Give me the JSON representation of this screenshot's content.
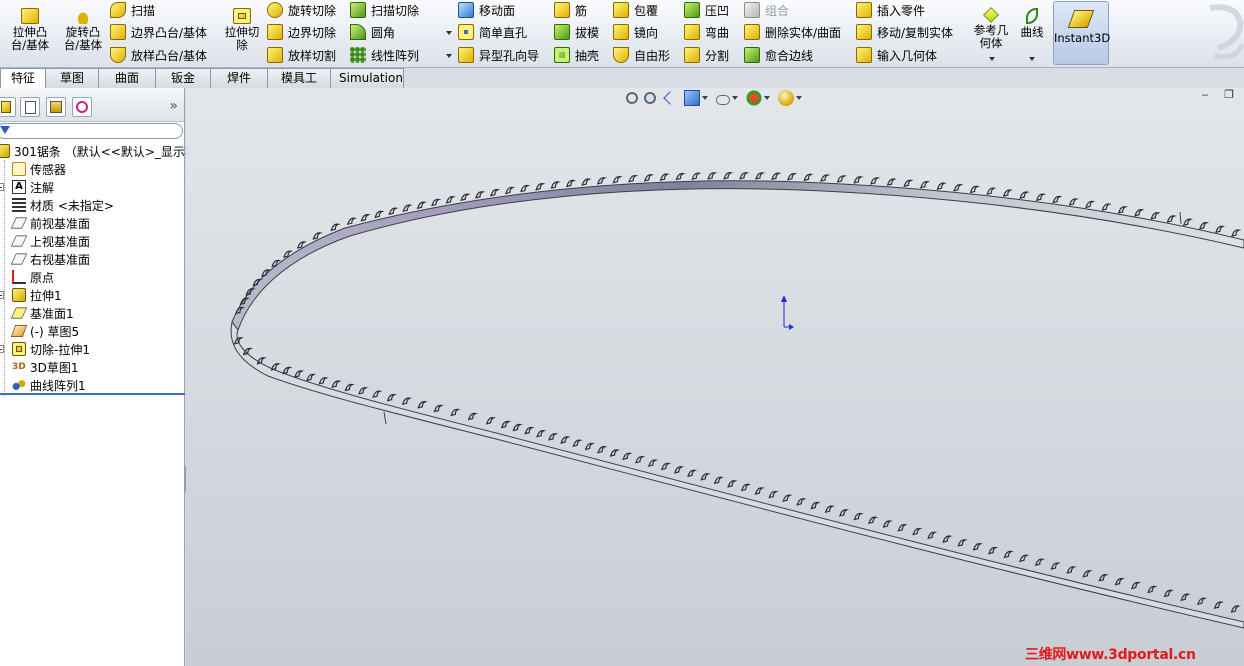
{
  "ribbon": {
    "extrude_boss": "拉伸凸\n台/基体",
    "revolve_boss": "旋转凸\n台/基体",
    "sweep": "扫描",
    "boundary_boss": "边界凸台/基体",
    "loft_boss": "放样凸台/基体",
    "extrude_cut": "拉伸切\n除",
    "revolve_cut": "旋转切除",
    "boundary_cut": "边界切除",
    "loft_cut": "放样切割",
    "swept_cut": "扫描切除",
    "fillet": "圆角",
    "linear_pattern": "线性阵列",
    "move_face": "移动面",
    "simple_hole": "简单直孔",
    "hole_wizard": "异型孔向导",
    "rib": "筋",
    "draft": "拔模",
    "shell": "抽壳",
    "wrap": "包覆",
    "mirror": "镜向",
    "freeform": "自由形",
    "indent": "压凹",
    "flex": "弯曲",
    "split": "分割",
    "combine": "组合",
    "delete_body": "删除实体/曲面",
    "knit_edges": "愈合边线",
    "insert_part": "插入零件",
    "move_copy_body": "移动/复制实体",
    "import_geometry": "输入几何体",
    "ref_geometry": "参考几\n何体",
    "curves": "曲线",
    "instant3d": "Instant3D"
  },
  "tabs": [
    "特征",
    "草图",
    "曲面",
    "钣金",
    "焊件",
    "模具工具",
    "Simulation"
  ],
  "active_tab": "特征",
  "tree": {
    "root": "301锯条 （默认<<默认>_显示状",
    "items": [
      {
        "label": "传感器",
        "icon": "sensor-icon",
        "expandable": false
      },
      {
        "label": "注解",
        "icon": "annotation-icon",
        "expandable": true
      },
      {
        "label": "材质 <未指定>",
        "icon": "material-icon",
        "expandable": false
      },
      {
        "label": "前视基准面",
        "icon": "plane-icon",
        "expandable": false
      },
      {
        "label": "上视基准面",
        "icon": "plane-icon",
        "expandable": false
      },
      {
        "label": "右视基准面",
        "icon": "plane-icon",
        "expandable": false
      },
      {
        "label": "原点",
        "icon": "origin-icon",
        "expandable": false
      },
      {
        "label": "拉伸1",
        "icon": "extrude-feature-icon",
        "expandable": true
      },
      {
        "label": "基准面1",
        "icon": "plane-icon",
        "expandable": false
      },
      {
        "label": "(-) 草图5",
        "icon": "sketch-icon",
        "expandable": false
      },
      {
        "label": "切除-拉伸1",
        "icon": "cut-feature-icon",
        "expandable": true
      },
      {
        "label": "3D草图1",
        "icon": "3d-sketch-icon",
        "expandable": false
      },
      {
        "label": "曲线阵列1",
        "icon": "curve-pattern-icon",
        "expandable": false
      }
    ]
  },
  "panel_expand": "»",
  "watermark": "三维网www.3dportal.cn",
  "colors": {
    "ribbon_bg": "#e7ebf1",
    "viewport_bg": "#d4d8de",
    "blade_edge": "#3a3f4a",
    "watermark": "#e41a1a",
    "axis_blue": "#1a2fd8"
  }
}
